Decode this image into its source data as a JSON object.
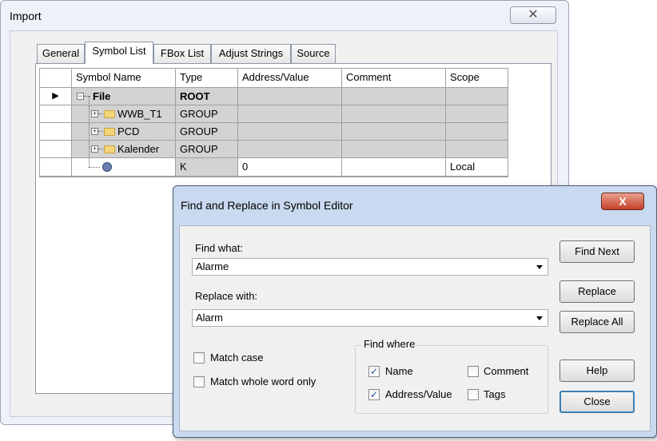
{
  "import_window": {
    "title": "Import",
    "close_glyph": "✕",
    "tabs": [
      {
        "label": "General"
      },
      {
        "label": "Symbol List"
      },
      {
        "label": "FBox List"
      },
      {
        "label": "Adjust Strings"
      },
      {
        "label": "Source"
      }
    ],
    "active_tab": "Symbol List",
    "grid": {
      "columns": [
        "Symbol Name",
        "Type",
        "Address/Value",
        "Comment",
        "Scope"
      ],
      "rows": [
        {
          "name": "File",
          "type": "ROOT",
          "address": "",
          "comment": "",
          "scope": ""
        },
        {
          "name": "WWB_T1",
          "type": "GROUP",
          "address": "",
          "comment": "",
          "scope": ""
        },
        {
          "name": "PCD",
          "type": "GROUP",
          "address": "",
          "comment": "",
          "scope": ""
        },
        {
          "name": "Kalender",
          "type": "GROUP",
          "address": "",
          "comment": "",
          "scope": ""
        },
        {
          "name": "",
          "type": "K",
          "address": "0",
          "comment": "",
          "scope": "Local"
        }
      ],
      "row_pointer": "▶"
    }
  },
  "find_replace": {
    "title": "Find and Replace in Symbol Editor",
    "close_glyph": "X",
    "find_what_label": "Find what:",
    "find_what_value": "Alarme",
    "replace_with_label": "Replace with:",
    "replace_with_value": "Alarm",
    "match_case_label": "Match case",
    "match_case_checked": false,
    "match_whole_word_label": "Match whole word only",
    "match_whole_word_checked": false,
    "find_where": {
      "title": "Find where",
      "name_label": "Name",
      "name_checked": true,
      "comment_label": "Comment",
      "comment_checked": false,
      "address_label": "Address/Value",
      "address_checked": true,
      "tags_label": "Tags",
      "tags_checked": false
    },
    "buttons": {
      "find_next": "Find Next",
      "replace": "Replace",
      "replace_all": "Replace All",
      "help": "Help",
      "close": "Close"
    },
    "check_glyph": "✓"
  }
}
